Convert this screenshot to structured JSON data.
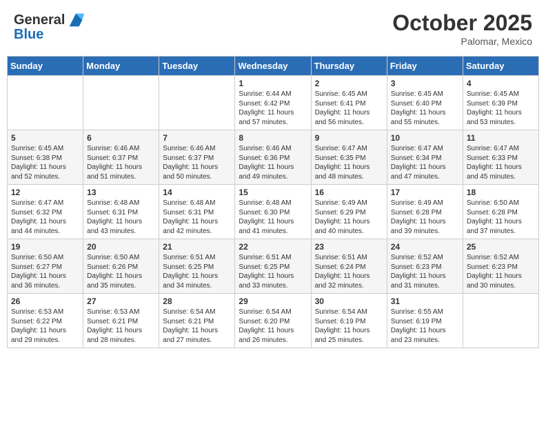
{
  "header": {
    "logo_line1": "General",
    "logo_line2": "Blue",
    "month_title": "October 2025",
    "location": "Palomar, Mexico"
  },
  "days_of_week": [
    "Sunday",
    "Monday",
    "Tuesday",
    "Wednesday",
    "Thursday",
    "Friday",
    "Saturday"
  ],
  "weeks": [
    [
      {
        "day": "",
        "info": ""
      },
      {
        "day": "",
        "info": ""
      },
      {
        "day": "",
        "info": ""
      },
      {
        "day": "1",
        "info": "Sunrise: 6:44 AM\nSunset: 6:42 PM\nDaylight: 11 hours and 57 minutes."
      },
      {
        "day": "2",
        "info": "Sunrise: 6:45 AM\nSunset: 6:41 PM\nDaylight: 11 hours and 56 minutes."
      },
      {
        "day": "3",
        "info": "Sunrise: 6:45 AM\nSunset: 6:40 PM\nDaylight: 11 hours and 55 minutes."
      },
      {
        "day": "4",
        "info": "Sunrise: 6:45 AM\nSunset: 6:39 PM\nDaylight: 11 hours and 53 minutes."
      }
    ],
    [
      {
        "day": "5",
        "info": "Sunrise: 6:45 AM\nSunset: 6:38 PM\nDaylight: 11 hours and 52 minutes."
      },
      {
        "day": "6",
        "info": "Sunrise: 6:46 AM\nSunset: 6:37 PM\nDaylight: 11 hours and 51 minutes."
      },
      {
        "day": "7",
        "info": "Sunrise: 6:46 AM\nSunset: 6:37 PM\nDaylight: 11 hours and 50 minutes."
      },
      {
        "day": "8",
        "info": "Sunrise: 6:46 AM\nSunset: 6:36 PM\nDaylight: 11 hours and 49 minutes."
      },
      {
        "day": "9",
        "info": "Sunrise: 6:47 AM\nSunset: 6:35 PM\nDaylight: 11 hours and 48 minutes."
      },
      {
        "day": "10",
        "info": "Sunrise: 6:47 AM\nSunset: 6:34 PM\nDaylight: 11 hours and 47 minutes."
      },
      {
        "day": "11",
        "info": "Sunrise: 6:47 AM\nSunset: 6:33 PM\nDaylight: 11 hours and 45 minutes."
      }
    ],
    [
      {
        "day": "12",
        "info": "Sunrise: 6:47 AM\nSunset: 6:32 PM\nDaylight: 11 hours and 44 minutes."
      },
      {
        "day": "13",
        "info": "Sunrise: 6:48 AM\nSunset: 6:31 PM\nDaylight: 11 hours and 43 minutes."
      },
      {
        "day": "14",
        "info": "Sunrise: 6:48 AM\nSunset: 6:31 PM\nDaylight: 11 hours and 42 minutes."
      },
      {
        "day": "15",
        "info": "Sunrise: 6:48 AM\nSunset: 6:30 PM\nDaylight: 11 hours and 41 minutes."
      },
      {
        "day": "16",
        "info": "Sunrise: 6:49 AM\nSunset: 6:29 PM\nDaylight: 11 hours and 40 minutes."
      },
      {
        "day": "17",
        "info": "Sunrise: 6:49 AM\nSunset: 6:28 PM\nDaylight: 11 hours and 39 minutes."
      },
      {
        "day": "18",
        "info": "Sunrise: 6:50 AM\nSunset: 6:28 PM\nDaylight: 11 hours and 37 minutes."
      }
    ],
    [
      {
        "day": "19",
        "info": "Sunrise: 6:50 AM\nSunset: 6:27 PM\nDaylight: 11 hours and 36 minutes."
      },
      {
        "day": "20",
        "info": "Sunrise: 6:50 AM\nSunset: 6:26 PM\nDaylight: 11 hours and 35 minutes."
      },
      {
        "day": "21",
        "info": "Sunrise: 6:51 AM\nSunset: 6:25 PM\nDaylight: 11 hours and 34 minutes."
      },
      {
        "day": "22",
        "info": "Sunrise: 6:51 AM\nSunset: 6:25 PM\nDaylight: 11 hours and 33 minutes."
      },
      {
        "day": "23",
        "info": "Sunrise: 6:51 AM\nSunset: 6:24 PM\nDaylight: 11 hours and 32 minutes."
      },
      {
        "day": "24",
        "info": "Sunrise: 6:52 AM\nSunset: 6:23 PM\nDaylight: 11 hours and 31 minutes."
      },
      {
        "day": "25",
        "info": "Sunrise: 6:52 AM\nSunset: 6:23 PM\nDaylight: 11 hours and 30 minutes."
      }
    ],
    [
      {
        "day": "26",
        "info": "Sunrise: 6:53 AM\nSunset: 6:22 PM\nDaylight: 11 hours and 29 minutes."
      },
      {
        "day": "27",
        "info": "Sunrise: 6:53 AM\nSunset: 6:21 PM\nDaylight: 11 hours and 28 minutes."
      },
      {
        "day": "28",
        "info": "Sunrise: 6:54 AM\nSunset: 6:21 PM\nDaylight: 11 hours and 27 minutes."
      },
      {
        "day": "29",
        "info": "Sunrise: 6:54 AM\nSunset: 6:20 PM\nDaylight: 11 hours and 26 minutes."
      },
      {
        "day": "30",
        "info": "Sunrise: 6:54 AM\nSunset: 6:19 PM\nDaylight: 11 hours and 25 minutes."
      },
      {
        "day": "31",
        "info": "Sunrise: 6:55 AM\nSunset: 6:19 PM\nDaylight: 11 hours and 23 minutes."
      },
      {
        "day": "",
        "info": ""
      }
    ]
  ]
}
